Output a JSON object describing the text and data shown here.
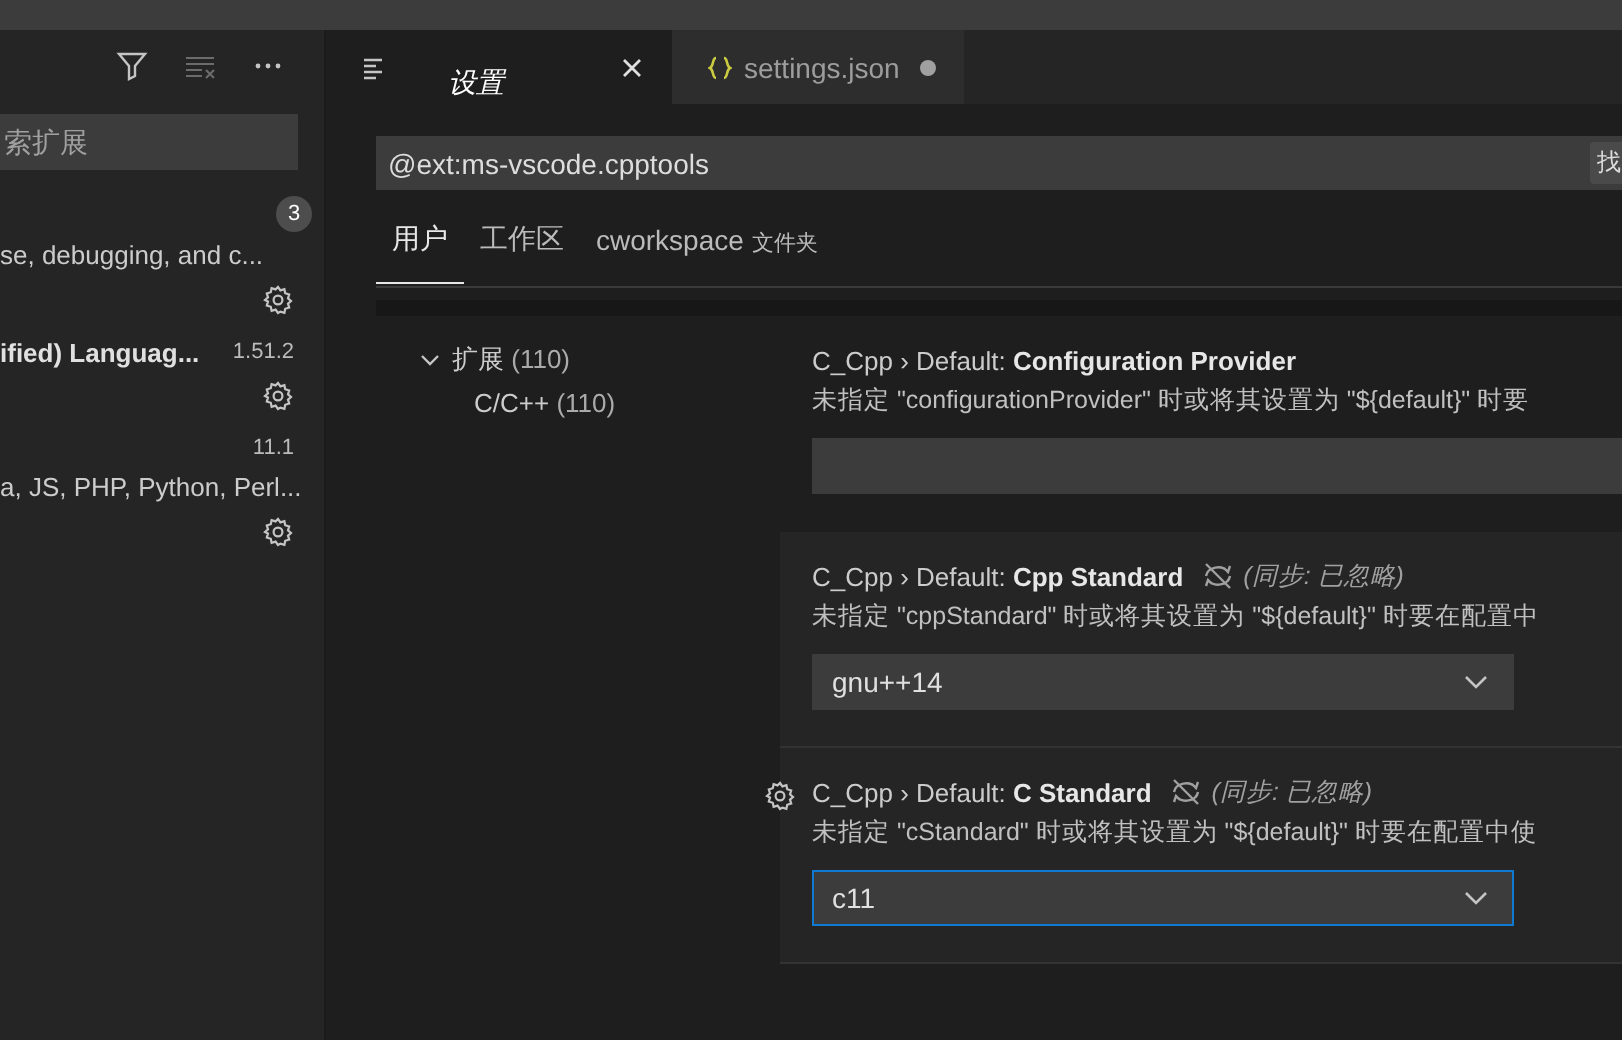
{
  "sidebar": {
    "search": {
      "placeholder": "索扩展"
    },
    "badge": "3",
    "extensions": [
      {
        "description": "se, debugging, and c..."
      },
      {
        "name": "ified) Languag...",
        "version": "1.51.2"
      },
      {
        "version": "11.1",
        "description": "a, JS, PHP, Python, Perl..."
      }
    ]
  },
  "tabs": [
    {
      "label": "设置",
      "kind": "settings",
      "selected": true,
      "dirty": false
    },
    {
      "label": "settings.json",
      "kind": "json",
      "selected": false,
      "dirty": true
    }
  ],
  "settings": {
    "search": {
      "value": "@ext:ms-vscode.cpptools"
    },
    "find_button": "找",
    "scopes": [
      {
        "label": "用户",
        "selected": true
      },
      {
        "label": "工作区",
        "selected": false
      },
      {
        "label": "cworkspace",
        "note": "文件夹",
        "selected": false
      }
    ],
    "toc": [
      {
        "label": "扩展",
        "count": "(110)",
        "expanded": true,
        "children": [
          {
            "label": "C/C++",
            "count": "(110)"
          }
        ]
      }
    ],
    "items": [
      {
        "category": "C_Cpp › Default: ",
        "name": "Configuration Provider",
        "sync_ignored": false,
        "description": "未指定 \"configurationProvider\" 时或将其设置为 \"${default}\" 时要",
        "kind": "text",
        "focused": false
      },
      {
        "category": "C_Cpp › Default: ",
        "name": "Cpp Standard",
        "sync_ignored": true,
        "sync_note": "(同步: 已忽略)",
        "description": "未指定 \"cppStandard\" 时或将其设置为 \"${default}\" 时要在配置中",
        "kind": "dropdown",
        "value": "gnu++14",
        "focused": false
      },
      {
        "category": "C_Cpp › Default: ",
        "name": "C Standard",
        "sync_ignored": true,
        "sync_note": "(同步: 已忽略)",
        "description": "未指定 \"cStandard\" 时或将其设置为 \"${default}\" 时要在配置中使",
        "kind": "dropdown",
        "value": "c11",
        "focused": true
      }
    ]
  }
}
